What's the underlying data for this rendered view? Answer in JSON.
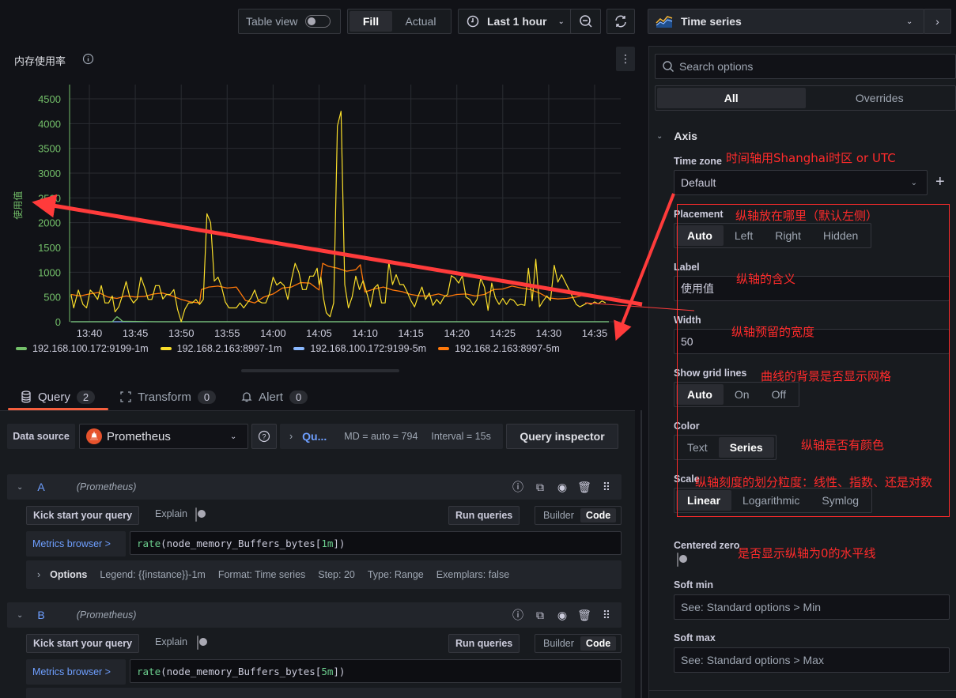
{
  "toolbar": {
    "table_view_label": "Table view",
    "table_view_on": false,
    "fill_label": "Fill",
    "actual_label": "Actual",
    "time_range_label": "Last 1 hour"
  },
  "visualization": {
    "type_label": "Time series"
  },
  "panel": {
    "title": "内存使用率"
  },
  "chart_data": {
    "type": "line",
    "title": "内存使用率",
    "ylabel": "使用值",
    "xlabel": "",
    "ylim": [
      0,
      4700
    ],
    "yticks": [
      0,
      500,
      1000,
      1500,
      2000,
      2500,
      3000,
      3500,
      4000,
      4500
    ],
    "xticks": [
      "13:40",
      "13:45",
      "13:50",
      "13:55",
      "14:00",
      "14:05",
      "14:10",
      "14:15",
      "14:20",
      "14:25",
      "14:30",
      "14:35"
    ],
    "x_range_minutes": [
      38.0,
      73.5
    ],
    "x_tick_minutes": [
      40,
      45,
      50,
      55,
      60,
      65,
      70,
      75,
      80,
      85,
      90,
      95
    ],
    "grid": true,
    "legend_position": "bottom",
    "series": [
      {
        "name": "192.168.100.172:9199-1m",
        "color": "#73bf69",
        "x": [
          38.0,
          42.5,
          42.8,
          43.0,
          43.3,
          43.6,
          47.3,
          98.0
        ],
        "y": [
          0,
          0,
          60,
          100,
          60,
          10,
          0,
          0
        ]
      },
      {
        "name": "192.168.2.163:8997-1m",
        "color": "#fade2a",
        "x": [
          38.0,
          38.3,
          38.8,
          39.3,
          39.7,
          40.1,
          40.5,
          40.9,
          41.3,
          41.7,
          42.1,
          42.5,
          42.8,
          43.2,
          43.6,
          44.0,
          44.4,
          44.8,
          45.2,
          45.6,
          46.0,
          46.4,
          46.8,
          47.2,
          47.6,
          48.0,
          48.4,
          48.8,
          49.2,
          49.6,
          50.0,
          50.4,
          50.8,
          51.2,
          51.6,
          52.0,
          52.4,
          52.8,
          53.2,
          53.6,
          54.0,
          54.4,
          54.8,
          55.2,
          55.6,
          56.0,
          56.4,
          56.8,
          57.2,
          57.6,
          58.0,
          58.4,
          58.8,
          59.2,
          59.6,
          60.0,
          60.4,
          60.8,
          61.2,
          61.6,
          62.0,
          62.4,
          62.8,
          63.2,
          63.6,
          64.0,
          64.4,
          64.8,
          65.0,
          65.2,
          65.5,
          65.8,
          66.2,
          66.6,
          67.0,
          67.4,
          67.8,
          68.2,
          68.6,
          69.0,
          69.4,
          69.8,
          70.2,
          70.6,
          71.0,
          71.4,
          71.8,
          72.2,
          72.6,
          73.0,
          73.4,
          73.8,
          74.2,
          74.6,
          75.0,
          75.4,
          75.8,
          76.2,
          76.6,
          77.0,
          77.4,
          77.8,
          78.2,
          78.6,
          79.0,
          79.4,
          79.8,
          80.2,
          80.6,
          81.0,
          81.4,
          81.8,
          82.2,
          82.6,
          83.0,
          83.4,
          83.8,
          84.2,
          84.6,
          85.0,
          85.4,
          85.8,
          86.2,
          86.6,
          87.0,
          87.4,
          87.8,
          88.2,
          88.6,
          89.0,
          89.4,
          89.8,
          90.2,
          90.6,
          91.0,
          91.4,
          91.8,
          92.2,
          92.6,
          93.0,
          93.4,
          93.8,
          94.2,
          94.6,
          95.0,
          95.4,
          95.8,
          96.2,
          96.6,
          97.0
        ],
        "y": [
          550,
          280,
          640,
          350,
          280,
          640,
          560,
          450,
          730,
          380,
          380,
          520,
          200,
          300,
          530,
          810,
          500,
          380,
          460,
          900,
          700,
          450,
          450,
          730,
          730,
          460,
          550,
          550,
          650,
          250,
          0,
          250,
          380,
          380,
          450,
          350,
          450,
          2180,
          2000,
          820,
          900,
          700,
          400,
          280,
          280,
          280,
          380,
          280,
          380,
          480,
          640,
          420,
          380,
          380,
          560,
          900,
          740,
          800,
          730,
          450,
          850,
          1180,
          1000,
          650,
          650,
          920,
          920,
          1080,
          750,
          900,
          460,
          180,
          100,
          380,
          3950,
          4250,
          750,
          280,
          500,
          920,
          650,
          830,
          580,
          300,
          680,
          750,
          380,
          380,
          1200,
          750,
          950,
          750,
          750,
          600,
          430,
          300,
          520,
          700,
          450,
          580,
          330,
          450,
          360,
          500,
          550,
          930,
          880,
          780,
          930,
          500,
          450,
          330,
          450,
          880,
          700,
          230,
          780,
          480,
          350,
          470,
          350,
          460,
          430,
          330,
          350,
          330,
          1080,
          420,
          1260,
          300,
          420,
          520,
          430,
          1140,
          800,
          950,
          800,
          650,
          500,
          350,
          300,
          340,
          380,
          350,
          400,
          360,
          420,
          380
        ]
      },
      {
        "name": "192.168.100.172:9199-5m",
        "color": "#8ab8ff",
        "x": [
          38.0,
          98.0
        ],
        "y": [
          0,
          0
        ]
      },
      {
        "name": "192.168.2.163:8997-5m",
        "color": "#ff780a",
        "x": [
          38.0,
          39.0,
          40.0,
          41.0,
          42.0,
          43.0,
          44.0,
          45.0,
          46.0,
          47.0,
          48.0,
          49.0,
          50.0,
          51.0,
          52.0,
          52.2,
          53.0,
          54.0,
          55.0,
          56.0,
          57.0,
          58.0,
          59.0,
          60.0,
          61.0,
          62.0,
          63.0,
          64.0,
          65.0,
          65.4,
          66.0,
          67.0,
          68.0,
          69.0,
          69.5,
          70.0,
          71.0,
          72.0,
          73.0,
          74.0,
          75.0,
          76.0,
          77.0,
          78.0,
          79.0,
          80.0,
          81.0,
          82.0,
          83.0,
          84.0,
          85.0,
          86.0,
          87.0,
          88.0,
          89.0,
          90.0,
          91.0,
          92.0,
          93.0,
          94.0,
          95.0,
          96.0,
          97.0
        ],
        "y": [
          550,
          520,
          560,
          590,
          500,
          470,
          520,
          500,
          510,
          560,
          580,
          520,
          450,
          400,
          380,
          650,
          700,
          720,
          680,
          700,
          430,
          380,
          500,
          560,
          680,
          700,
          790,
          780,
          640,
          1180,
          1120,
          1080,
          1020,
          1050,
          1150,
          600,
          660,
          700,
          640,
          610,
          550,
          520,
          520,
          560,
          510,
          550,
          560,
          520,
          550,
          650,
          660,
          720,
          680,
          650,
          580,
          480,
          460,
          470,
          500,
          550,
          530,
          500,
          470
        ]
      }
    ]
  },
  "tabs": [
    {
      "label": "Query",
      "count": "2"
    },
    {
      "label": "Transform",
      "count": "0"
    },
    {
      "label": "Alert",
      "count": "0"
    }
  ],
  "query_bar": {
    "data_source_label": "Data source",
    "data_source_value": "Prometheus",
    "query_options_label": "Qu...",
    "md_text": "MD = auto = 794",
    "interval_text": "Interval = 15s",
    "inspector_label": "Query inspector"
  },
  "queries": [
    {
      "ref": "A",
      "datasource": "(Prometheus)",
      "kick_start_label": "Kick start your query",
      "explain_label": "Explain",
      "run_label": "Run queries",
      "builder_label": "Builder",
      "code_label": "Code",
      "metrics_browser_label": "Metrics browser >",
      "expr_fn": "rate",
      "expr_mid": "(node_memory_Buffers_bytes[",
      "expr_range": "1m",
      "expr_end": "])",
      "options_label": "Options",
      "legend": "Legend: {{instance}}-1m",
      "format": "Format: Time series",
      "step": "Step: 20",
      "type": "Type: Range",
      "exemplars": "Exemplars: false"
    },
    {
      "ref": "B",
      "datasource": "(Prometheus)",
      "kick_start_label": "Kick start your query",
      "explain_label": "Explain",
      "run_label": "Run queries",
      "builder_label": "Builder",
      "code_label": "Code",
      "metrics_browser_label": "Metrics browser >",
      "expr_fn": "rate",
      "expr_mid": "(node_memory_Buffers_bytes[",
      "expr_range": "5m",
      "expr_end": "])"
    }
  ],
  "options_pane": {
    "search_placeholder": "Search options",
    "tab_all": "All",
    "tab_overrides": "Overrides",
    "section_title": "Axis",
    "time_zone_label": "Time zone",
    "time_zone_value": "Default",
    "placement_label": "Placement",
    "placement_options": [
      "Auto",
      "Left",
      "Right",
      "Hidden"
    ],
    "placement_selected": "Auto",
    "label_label": "Label",
    "label_value": "使用值",
    "width_label": "Width",
    "width_value": "50",
    "grid_label": "Show grid lines",
    "grid_options": [
      "Auto",
      "On",
      "Off"
    ],
    "grid_selected": "Auto",
    "color_label": "Color",
    "color_options": [
      "Text",
      "Series"
    ],
    "color_selected": "Series",
    "scale_label": "Scale",
    "scale_options": [
      "Linear",
      "Logarithmic",
      "Symlog"
    ],
    "scale_selected": "Linear",
    "centered_zero_label": "Centered zero",
    "centered_zero_on": false,
    "soft_min_label": "Soft min",
    "soft_min_placeholder": "See: Standard options > Min",
    "soft_max_label": "Soft max",
    "soft_max_placeholder": "See: Standard options > Max"
  },
  "annotations": {
    "time_zone": "时间轴用Shanghai时区 or UTC",
    "placement": "纵轴放在哪里（默认左侧）",
    "label": "纵轴的含义",
    "width": "纵轴预留的宽度",
    "grid": "曲线的背景是否显示网格",
    "color": "纵轴是否有颜色",
    "scale": "纵轴刻度的划分粒度：线性、指数、还是对数",
    "centered_zero": "是否显示纵轴为0的水平线"
  }
}
